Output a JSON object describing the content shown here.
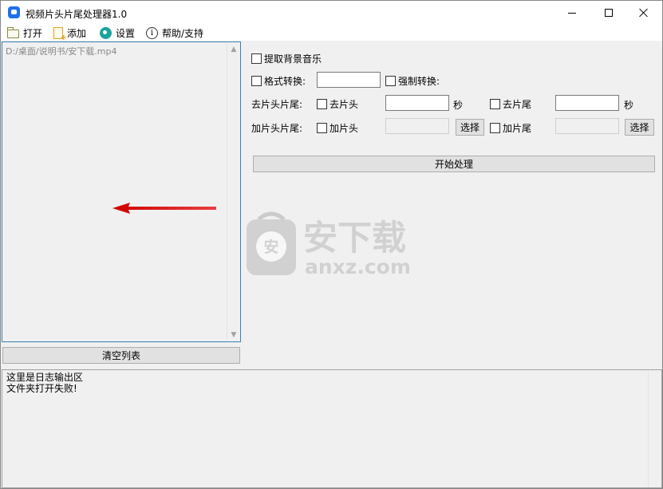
{
  "window": {
    "title": "视频片头片尾处理器1.0"
  },
  "menu": {
    "items": [
      {
        "label": "打开",
        "icon": "folder-icon"
      },
      {
        "label": "添加",
        "icon": "add-file-icon"
      },
      {
        "label": "设置",
        "icon": "gear-icon"
      },
      {
        "label": "帮助/支持",
        "icon": "info-icon"
      }
    ]
  },
  "file_list": {
    "entries": [
      "D:/桌面/说明书/安下载.mp4"
    ],
    "clear_label": "清空列表"
  },
  "options": {
    "extract_bgm": "提取背景音乐",
    "format_convert": "格式转换:",
    "format_value": "",
    "force_convert": "强制转换:",
    "remove_label": "去片头片尾:",
    "remove_head": "去片头",
    "remove_head_value": "",
    "remove_tail": "去片尾",
    "remove_tail_value": "",
    "seconds": "秒",
    "add_label": "加片头片尾:",
    "add_head": "加片头",
    "add_head_value": "",
    "add_tail": "加片尾",
    "add_tail_value": "",
    "choose": "选择",
    "start": "开始处理"
  },
  "watermark": {
    "badge": "安",
    "text_cn": "安下载",
    "text_en": "anxz.com"
  },
  "log": {
    "lines": [
      "这里是日志输出区",
      "文件夹打开失败!"
    ]
  },
  "colors": {
    "accent": "#1e6ff0",
    "arrow": "#e02020",
    "list_border": "#3c7fb1"
  }
}
